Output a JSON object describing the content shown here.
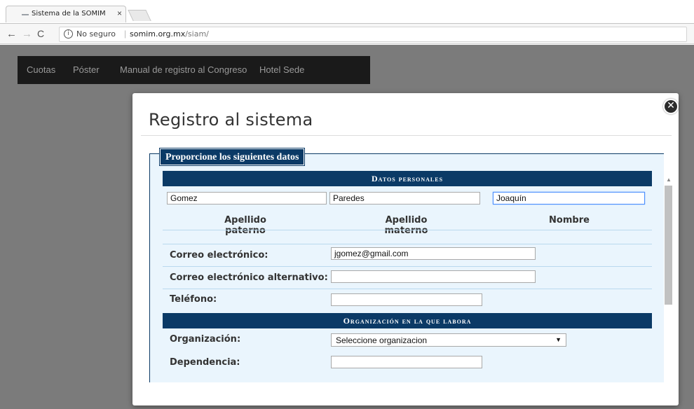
{
  "browser": {
    "tab_title": "Sistema de la SOMIM",
    "tab_close": "×",
    "nav_back": "←",
    "nav_forward": "→",
    "nav_reload": "C",
    "info_icon_glyph": "i",
    "security_label": "No seguro",
    "url_domain": "somim.org.mx",
    "url_path": "/siam/"
  },
  "site_nav": {
    "items": [
      "Cuotas",
      "Póster",
      "Manual de registro al Congreso",
      "Hotel Sede"
    ]
  },
  "modal": {
    "title": "Registro al sistema",
    "close_glyph": "✕",
    "legend": "Proporcione los siguientes datos",
    "sections": {
      "personal": "Datos personales",
      "organization": "Organización en la que labora"
    },
    "name_fields": {
      "apellido_paterno": {
        "value": "Gomez",
        "label": "Apellido paterno"
      },
      "apellido_materno": {
        "value": "Paredes",
        "label": "Apellido materno"
      },
      "nombre": {
        "value": "Joaquín",
        "label": "Nombre"
      }
    },
    "fields": {
      "email": {
        "label": "Correo electrónico:",
        "value": "jgomez@gmail.com"
      },
      "email_alt": {
        "label": "Correo electrónico alternativo:",
        "value": ""
      },
      "phone": {
        "label": "Teléfono:",
        "value": ""
      },
      "organization": {
        "label": "Organización:",
        "selected": "Seleccione organizacion"
      },
      "department": {
        "label": "Dependencia:",
        "value": ""
      }
    }
  },
  "colors": {
    "header_blue": "#0b3a66",
    "form_bg": "#eaf5fd",
    "overlay": "#7b7b7b",
    "nav_bg": "#1a1a1a"
  }
}
